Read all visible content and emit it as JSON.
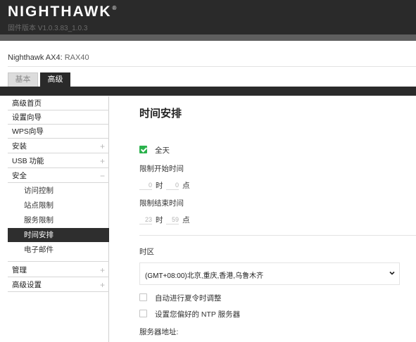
{
  "header": {
    "brand": "NIGHTHAWK",
    "trademark": "®",
    "firmware": "固件版本 V1.0.3.83_1.0.3"
  },
  "device": {
    "label": "Nighthawk AX4:",
    "model": "RAX40"
  },
  "tabs": [
    {
      "label": "基本",
      "active": false
    },
    {
      "label": "高级",
      "active": true
    }
  ],
  "sidebar": {
    "items": [
      {
        "label": "高级首页",
        "expander": ""
      },
      {
        "label": "设置向导",
        "expander": ""
      },
      {
        "label": "WPS向导",
        "expander": ""
      },
      {
        "label": "安装",
        "expander": "+"
      },
      {
        "label": "USB 功能",
        "expander": "+"
      },
      {
        "label": "安全",
        "expander": "−"
      },
      {
        "label": "访问控制",
        "expander": ""
      },
      {
        "label": "站点限制",
        "expander": ""
      },
      {
        "label": "服务限制",
        "expander": ""
      },
      {
        "label": "时间安排",
        "expander": ""
      },
      {
        "label": "电子邮件",
        "expander": ""
      },
      {
        "label": "管理",
        "expander": "+"
      },
      {
        "label": "高级设置",
        "expander": "+"
      }
    ]
  },
  "main": {
    "title": "时间安排",
    "all_day": {
      "label": "全天",
      "checked": true
    },
    "start": {
      "label": "限制开始时间",
      "hour": "0",
      "hour_unit": "时",
      "minute": "0",
      "minute_unit": "点"
    },
    "end": {
      "label": "限制结束时间",
      "hour": "23",
      "hour_unit": "时",
      "minute": "59",
      "minute_unit": "点"
    },
    "timezone": {
      "label": "时区",
      "value": "(GMT+08:00)北京,重庆,香港,乌鲁木齐"
    },
    "dst": {
      "label": "自动进行夏令时调整",
      "checked": false
    },
    "ntp": {
      "label": "设置您偏好的 NTP 服务器",
      "checked": false
    },
    "server_label": "服务器地址:"
  },
  "colors": {
    "header_bg": "#2a2a2a",
    "active_nav_bg": "#2e2e2e",
    "checkbox_green": "#2bb24c"
  }
}
